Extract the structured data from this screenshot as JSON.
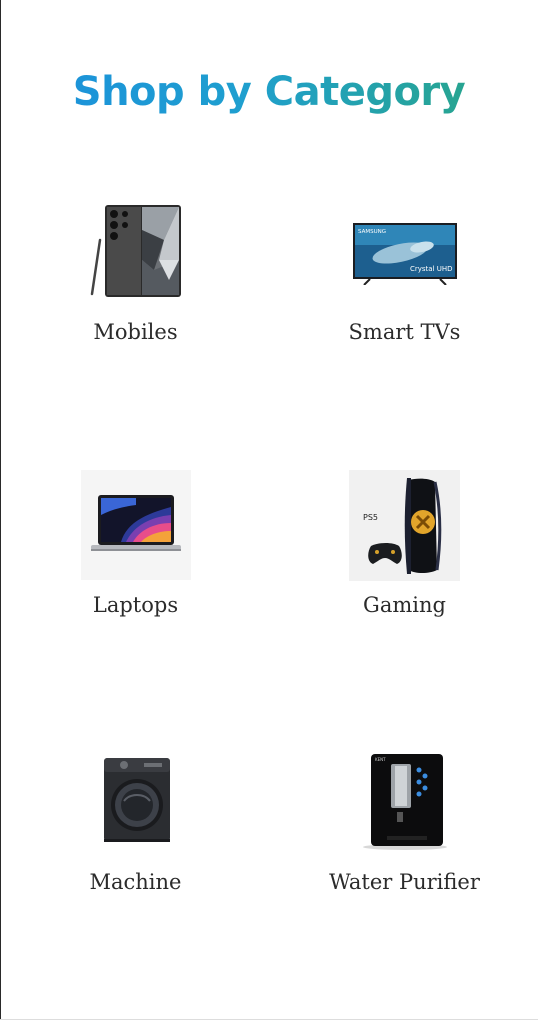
{
  "page": {
    "title": "Shop by Category"
  },
  "categories": [
    {
      "label": "Mobiles",
      "icon": "mobile-phone-image"
    },
    {
      "label": "Smart TVs",
      "icon": "smart-tv-image"
    },
    {
      "label": "Laptops",
      "icon": "laptop-image"
    },
    {
      "label": "Gaming",
      "icon": "gaming-console-image"
    },
    {
      "label": "Machine",
      "icon": "washing-machine-image"
    },
    {
      "label": "Water Purifier",
      "icon": "water-purifier-image"
    }
  ],
  "tv": {
    "brand": "SAMSUNG",
    "badge": "Crystal UHD"
  },
  "ps5": {
    "logo": "PS5"
  },
  "purifier": {
    "brand": "KENT"
  },
  "colors": {
    "title_gradient_start": "#1a8fdd",
    "title_gradient_end": "#2aa67d",
    "label_text": "#2b2b2b"
  }
}
